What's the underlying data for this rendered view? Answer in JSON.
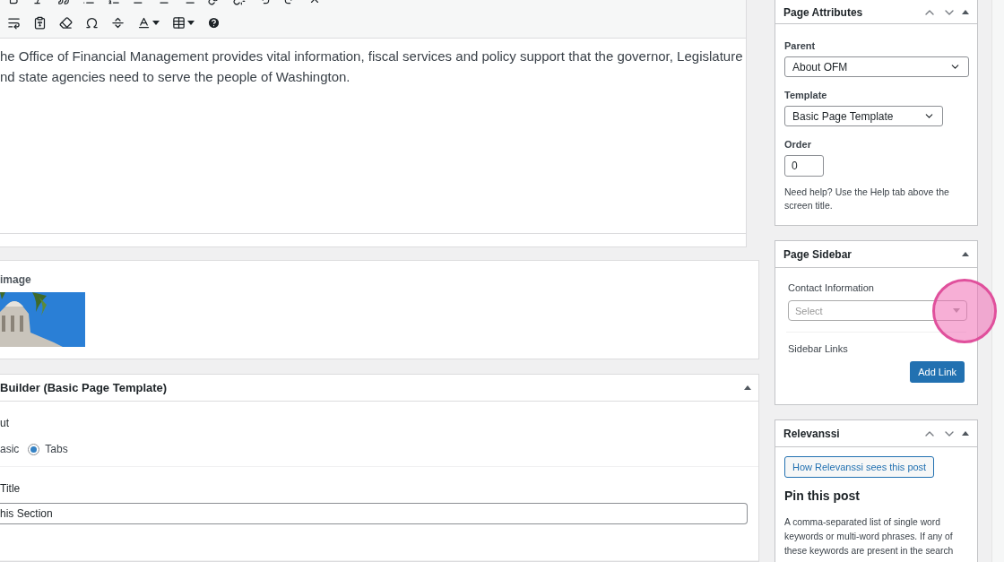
{
  "editor": {
    "paragraph": [
      "he Office of Financial Management provides vital information, fiscal services and policy support that the governor, Legislature",
      "nd state agencies need to serve the people of Washington."
    ]
  },
  "featured_image": {
    "label": "image"
  },
  "builder": {
    "title": "Builder (Basic Page Template)",
    "expanded": true,
    "layout": {
      "label": "ut",
      "basic_label": "asic",
      "tabs": {
        "label": "Tabs",
        "selected": true
      }
    },
    "section_title": {
      "label": "Title",
      "value": "his Section"
    }
  },
  "sidebar": {
    "page_attributes": {
      "title": "Page Attributes",
      "expanded": true,
      "parent": {
        "label": "Parent",
        "value": "About OFM"
      },
      "template": {
        "label": "Template",
        "value": "Basic Page Template"
      },
      "order": {
        "label": "Order",
        "value": "0"
      },
      "help": "Need help? Use the Help tab above the screen title."
    },
    "page_sidebar": {
      "title": "Page Sidebar",
      "expanded": true,
      "contact": {
        "label": "Contact Information",
        "placeholder": "Select"
      },
      "links": {
        "label": "Sidebar Links",
        "button": "Add Link"
      }
    },
    "relevanssi": {
      "title": "Relevanssi",
      "expanded": true,
      "button": "How Relevanssi sees this post",
      "heading": "Pin this post",
      "text": "A comma-separated list of single word keywords or multi-word phrases. If any of these keywords are present in the search"
    }
  }
}
